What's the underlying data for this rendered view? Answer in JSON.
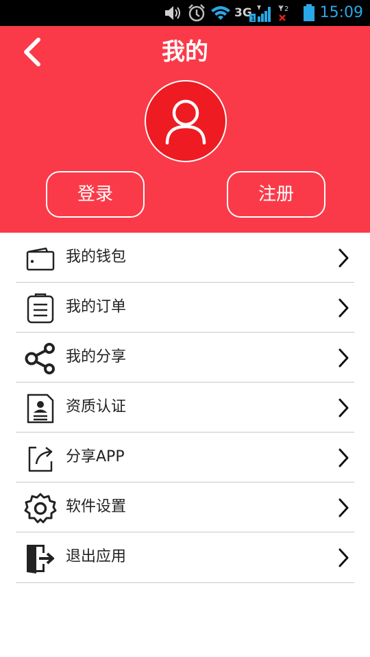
{
  "status_bar": {
    "network": "3G",
    "time": "15:09",
    "time_color": "#2aa7e6",
    "icons": [
      "volume-icon",
      "alarm-icon",
      "wifi-icon",
      "signal-sim1-icon",
      "signal-sim2-no-service-icon",
      "battery-icon"
    ]
  },
  "header": {
    "title": "我的",
    "background_color": "#fb3a49",
    "login_label": "登录",
    "register_label": "注册",
    "avatar_color": "#ee1b22"
  },
  "menu": {
    "items": [
      {
        "label": "我的钱包",
        "icon": "wallet-icon"
      },
      {
        "label": "我的订单",
        "icon": "order-clipboard-icon"
      },
      {
        "label": "我的分享",
        "icon": "share-nodes-icon"
      },
      {
        "label": "资质认证",
        "icon": "certificate-icon"
      },
      {
        "label": "分享APP",
        "icon": "share-app-icon"
      },
      {
        "label": "软件设置",
        "icon": "gear-icon"
      },
      {
        "label": "退出应用",
        "icon": "exit-door-icon"
      }
    ]
  }
}
